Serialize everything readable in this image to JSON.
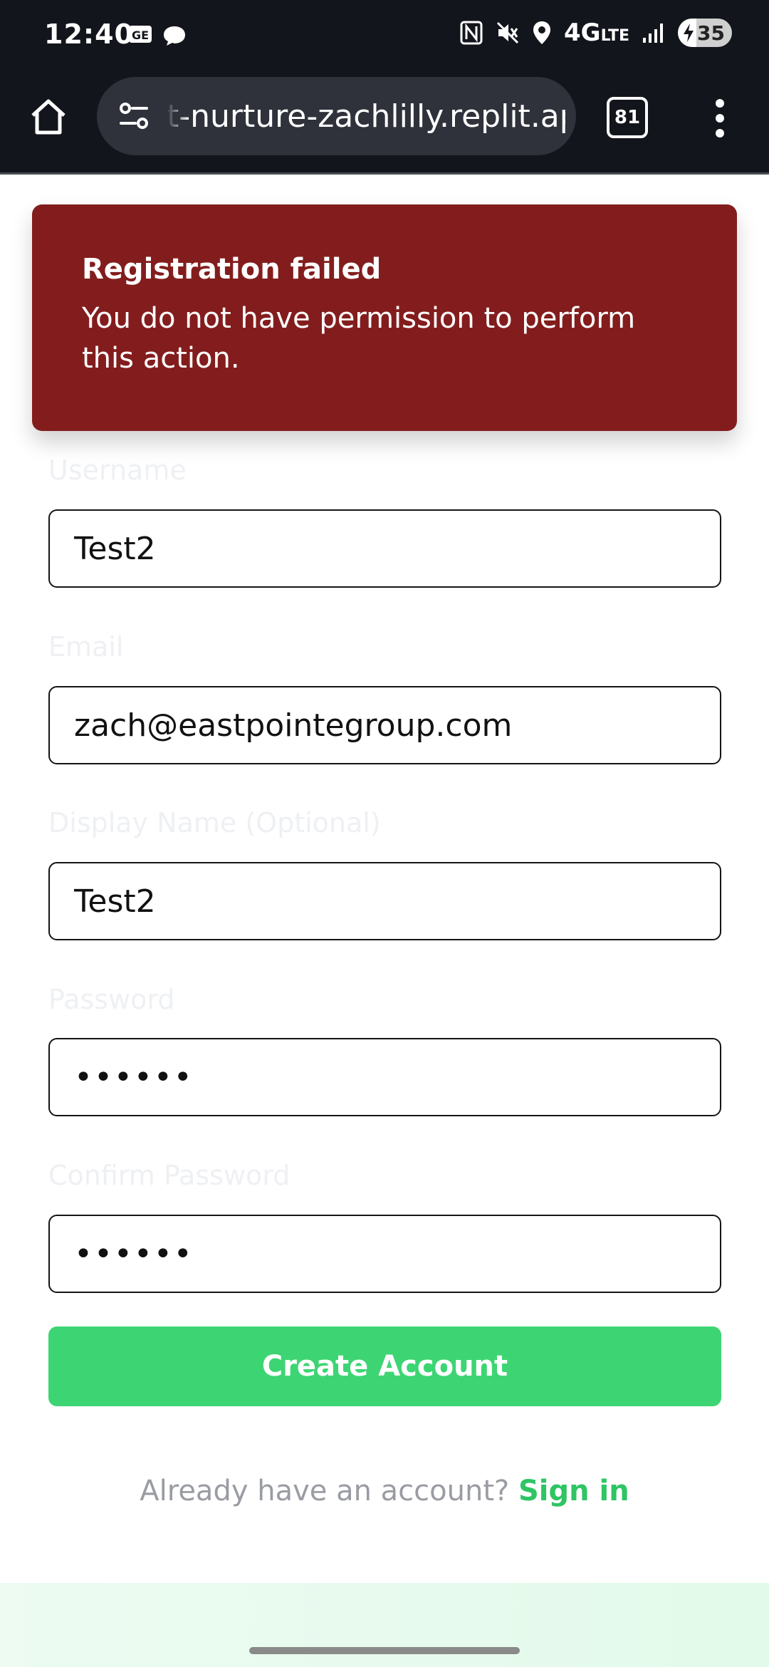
{
  "status_bar": {
    "time": "12:40",
    "network": "4G",
    "network_sub": "LTE",
    "battery": "35",
    "icons": [
      "gmail-icon",
      "chat-bubble-icon",
      "nfc-icon",
      "mute-icon",
      "location-icon",
      "signal-icon",
      "battery-charging-icon"
    ]
  },
  "browser": {
    "url": "t-nurture-zachlilly.replit.app",
    "tab_count": "81"
  },
  "toast": {
    "title": "Registration failed",
    "message": "You do not have permission to perform this action."
  },
  "form": {
    "username_label": "Username",
    "username_value": "Test2",
    "email_label": "Email",
    "email_value": "zach@eastpointegroup.com",
    "display_name_label": "Display Name (Optional)",
    "display_name_value": "Test2",
    "password_label": "Password",
    "password_value": "••••••",
    "confirm_password_label": "Confirm Password",
    "confirm_password_value": "••••••",
    "submit_label": "Create Account"
  },
  "footer": {
    "prompt": "Already have an account?",
    "link": "Sign in"
  },
  "colors": {
    "toast_bg": "#831d1d",
    "accent_green": "#3dd573",
    "link_green": "#2fc464"
  }
}
